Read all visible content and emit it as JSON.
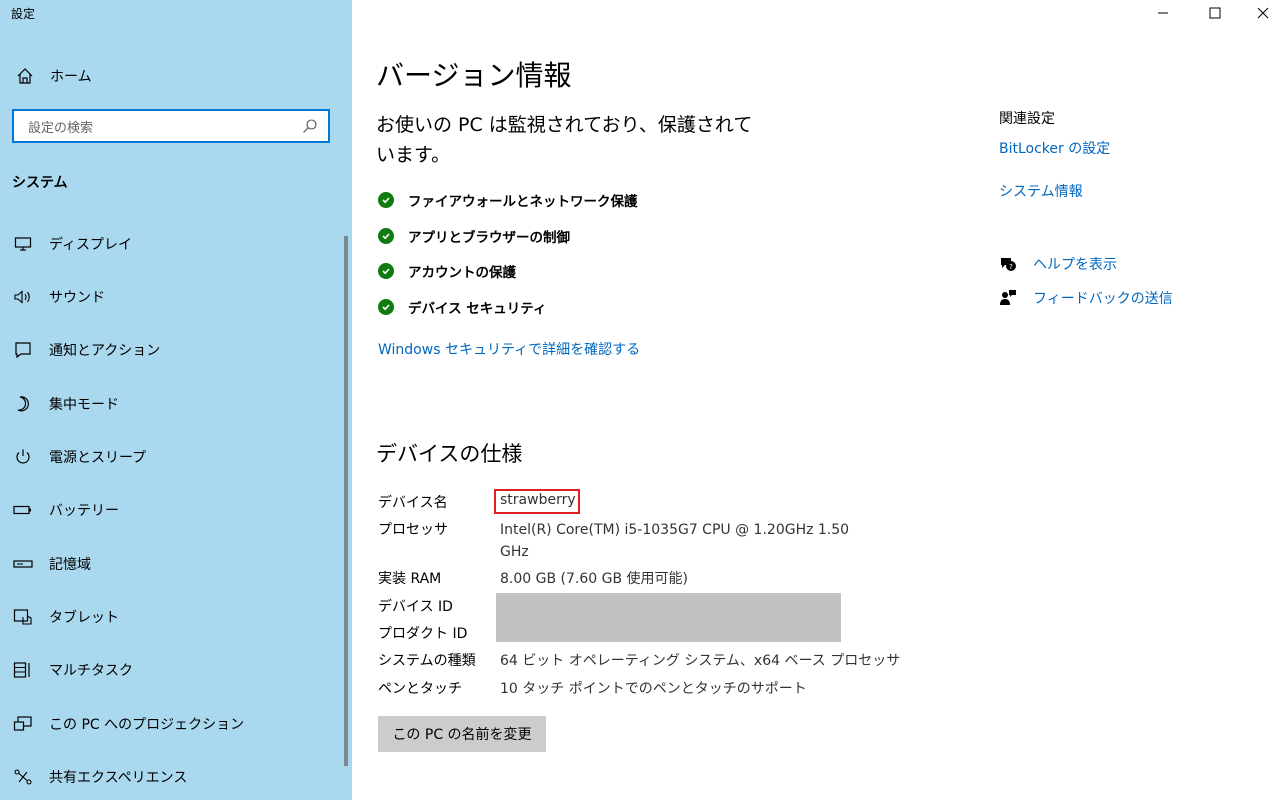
{
  "window": {
    "title": "設定",
    "controls": {
      "minimize": "minimize-icon",
      "maximize": "maximize-icon",
      "close": "close-icon"
    }
  },
  "sidebar": {
    "home_label": "ホーム",
    "search_placeholder": "設定の検索",
    "section_label": "システム",
    "items": [
      {
        "label": "ディスプレイ",
        "icon": "monitor-icon"
      },
      {
        "label": "サウンド",
        "icon": "speaker-icon"
      },
      {
        "label": "通知とアクション",
        "icon": "notification-icon"
      },
      {
        "label": "集中モード",
        "icon": "moon-icon"
      },
      {
        "label": "電源とスリープ",
        "icon": "power-icon"
      },
      {
        "label": "バッテリー",
        "icon": "battery-icon"
      },
      {
        "label": "記憶域",
        "icon": "storage-icon"
      },
      {
        "label": "タブレット",
        "icon": "tablet-icon"
      },
      {
        "label": "マルチタスク",
        "icon": "multitask-icon"
      },
      {
        "label": "この PC へのプロジェクション",
        "icon": "projection-icon"
      },
      {
        "label": "共有エクスペリエンス",
        "icon": "shared-experience-icon"
      }
    ]
  },
  "main": {
    "title": "バージョン情報",
    "protection_status": "お使いの PC は監視されており、保護されています。",
    "protections": [
      "ファイアウォールとネットワーク保護",
      "アプリとブラウザーの制御",
      "アカウントの保護",
      "デバイス セキュリティ"
    ],
    "security_link": "Windows セキュリティで詳細を確認する",
    "spec_title": "デバイスの仕様",
    "specs": {
      "device_name": {
        "label": "デバイス名",
        "value": "strawberry"
      },
      "processor": {
        "label": "プロセッサ",
        "value": "Intel(R) Core(TM) i5-1035G7 CPU @ 1.20GHz   1.50 GHz"
      },
      "ram": {
        "label": "実装 RAM",
        "value": "8.00 GB (7.60 GB 使用可能)"
      },
      "device_id": {
        "label": "デバイス ID"
      },
      "product_id": {
        "label": "プロダクト ID"
      },
      "system_type": {
        "label": "システムの種類",
        "value": "64 ビット オペレーティング システム、x64 ベース プロセッサ"
      },
      "pen_touch": {
        "label": "ペンとタッチ",
        "value": "10 タッチ ポイントでのペンとタッチのサポート"
      }
    },
    "rename_button": "この PC の名前を変更"
  },
  "related": {
    "title": "関連設定",
    "links": [
      "BitLocker の設定",
      "システム情報"
    ],
    "help": {
      "label": "ヘルプを表示",
      "icon": "help-icon"
    },
    "feedback": {
      "label": "フィードバックの送信",
      "icon": "feedback-icon"
    }
  },
  "colors": {
    "sidebar_bg": "#aad8ee",
    "accent": "#0078d7",
    "link": "#0067c0",
    "check_green": "#107c10",
    "highlight_red": "#e02020"
  }
}
